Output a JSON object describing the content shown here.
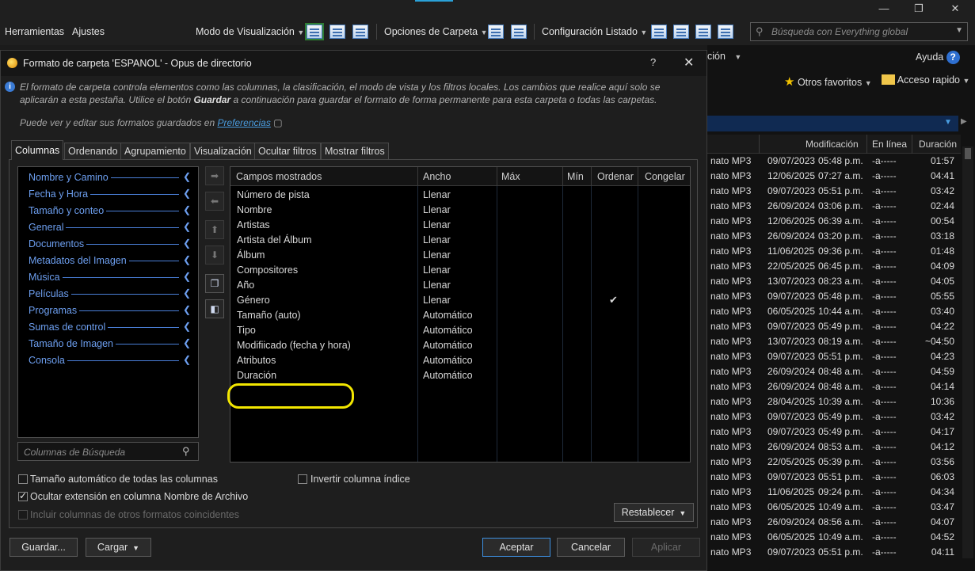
{
  "window": {
    "minimize_glyph": "—",
    "maximize_glyph": "❐",
    "close_glyph": "✕"
  },
  "toolbar": {
    "herramientas": "Herramientas",
    "ajustes": "Ajustes",
    "modo_visualizacion": "Modo de Visualización",
    "opciones_carpeta": "Opciones de Carpeta",
    "configuracion_listado": "Configuración Listado",
    "search_placeholder": "Búsqueda con Everything global"
  },
  "background": {
    "menu_fragment": "ción",
    "ayuda": "Ayuda",
    "otros_favoritos": "Otros favoritos",
    "acceso_rapido": "Acceso rapido",
    "columns": [
      "Modificación",
      "En línea",
      "Duración"
    ],
    "rows": [
      {
        "type": "nato MP3",
        "date": "09/07/2023",
        "time": "05:48 p.m.",
        "attr": "-a-----",
        "dur": "01:57"
      },
      {
        "type": "nato MP3",
        "date": "12/06/2025",
        "time": "07:27 a.m.",
        "attr": "-a-----",
        "dur": "04:41"
      },
      {
        "type": "nato MP3",
        "date": "09/07/2023",
        "time": "05:51 p.m.",
        "attr": "-a-----",
        "dur": "03:42"
      },
      {
        "type": "nato MP3",
        "date": "26/09/2024",
        "time": "03:06 p.m.",
        "attr": "-a-----",
        "dur": "02:44"
      },
      {
        "type": "nato MP3",
        "date": "12/06/2025",
        "time": "06:39 a.m.",
        "attr": "-a-----",
        "dur": "00:54"
      },
      {
        "type": "nato MP3",
        "date": "26/09/2024",
        "time": "03:20 p.m.",
        "attr": "-a-----",
        "dur": "03:18"
      },
      {
        "type": "nato MP3",
        "date": "11/06/2025",
        "time": "09:36 p.m.",
        "attr": "-a-----",
        "dur": "01:48"
      },
      {
        "type": "nato MP3",
        "date": "22/05/2025",
        "time": "06:45 p.m.",
        "attr": "-a-----",
        "dur": "04:09"
      },
      {
        "type": "nato MP3",
        "date": "13/07/2023",
        "time": "08:23 a.m.",
        "attr": "-a-----",
        "dur": "04:05"
      },
      {
        "type": "nato MP3",
        "date": "09/07/2023",
        "time": "05:48 p.m.",
        "attr": "-a-----",
        "dur": "05:55"
      },
      {
        "type": "nato MP3",
        "date": "06/05/2025",
        "time": "10:44 a.m.",
        "attr": "-a-----",
        "dur": "03:40"
      },
      {
        "type": "nato MP3",
        "date": "09/07/2023",
        "time": "05:49 p.m.",
        "attr": "-a-----",
        "dur": "04:22"
      },
      {
        "type": "nato MP3",
        "date": "13/07/2023",
        "time": "08:19 a.m.",
        "attr": "-a-----",
        "dur": "~04:50"
      },
      {
        "type": "nato MP3",
        "date": "09/07/2023",
        "time": "05:51 p.m.",
        "attr": "-a-----",
        "dur": "04:23"
      },
      {
        "type": "nato MP3",
        "date": "26/09/2024",
        "time": "08:48 a.m.",
        "attr": "-a-----",
        "dur": "04:59"
      },
      {
        "type": "nato MP3",
        "date": "26/09/2024",
        "time": "08:48 a.m.",
        "attr": "-a-----",
        "dur": "04:14"
      },
      {
        "type": "nato MP3",
        "date": "28/04/2025",
        "time": "10:39 a.m.",
        "attr": "-a-----",
        "dur": "10:36"
      },
      {
        "type": "nato MP3",
        "date": "09/07/2023",
        "time": "05:49 p.m.",
        "attr": "-a-----",
        "dur": "03:42"
      },
      {
        "type": "nato MP3",
        "date": "09/07/2023",
        "time": "05:49 p.m.",
        "attr": "-a-----",
        "dur": "04:17"
      },
      {
        "type": "nato MP3",
        "date": "26/09/2024",
        "time": "08:53 a.m.",
        "attr": "-a-----",
        "dur": "04:12"
      },
      {
        "type": "nato MP3",
        "date": "22/05/2025",
        "time": "05:39 p.m.",
        "attr": "-a-----",
        "dur": "03:56"
      },
      {
        "type": "nato MP3",
        "date": "09/07/2023",
        "time": "05:51 p.m.",
        "attr": "-a-----",
        "dur": "06:03"
      },
      {
        "type": "nato MP3",
        "date": "11/06/2025",
        "time": "09:24 p.m.",
        "attr": "-a-----",
        "dur": "04:34"
      },
      {
        "type": "nato MP3",
        "date": "06/05/2025",
        "time": "10:49 a.m.",
        "attr": "-a-----",
        "dur": "03:47"
      },
      {
        "type": "nato MP3",
        "date": "26/09/2024",
        "time": "08:56 a.m.",
        "attr": "-a-----",
        "dur": "04:07"
      },
      {
        "type": "nato MP3",
        "date": "06/05/2025",
        "time": "10:49 a.m.",
        "attr": "-a-----",
        "dur": "04:52"
      },
      {
        "type": "nato MP3",
        "date": "09/07/2023",
        "time": "05:51 p.m.",
        "attr": "-a-----",
        "dur": "04:11"
      }
    ]
  },
  "dialog": {
    "title": "Formato de carpeta 'ESPANOL' - Opus de directorio",
    "help": "?",
    "close": "✕",
    "info_part1": "El formato de carpeta controla elementos como las columnas, la clasificación, el modo de vista y los filtros locales. Los cambios que realice aquí solo se aplicarán a esta pestaña. Utilice el botón ",
    "info_bold": "Guardar",
    "info_part2": " a continuación para guardar el formato de forma permanente para esta carpeta o todas las carpetas.",
    "pref_text": "Puede ver y editar sus formatos guardados en ",
    "pref_link": "Preferencias",
    "tabs": [
      "Columnas",
      "Ordenando",
      "Agrupamiento",
      "Visualización",
      "Ocultar filtros",
      "Mostrar filtros"
    ],
    "categories": [
      "Nombre y Camino",
      "Fecha y Hora",
      "Tamaño y conteo",
      "General",
      "Documentos",
      "Metadatos del Imagen",
      "Música",
      "Películas",
      "Programas",
      "Sumas de control",
      "Tamaño de Imagen",
      "Consola"
    ],
    "column_search_placeholder": "Columnas de Búsqueda",
    "table_headers": {
      "fields": "Campos mostrados",
      "width": "Ancho",
      "max": "Máx",
      "min": "Mín",
      "sort": "Ordenar",
      "freeze": "Congelar"
    },
    "fields": [
      {
        "name": "Número de pista",
        "width": "Llenar",
        "sort": ""
      },
      {
        "name": "Nombre",
        "width": "Llenar",
        "sort": ""
      },
      {
        "name": "Artistas",
        "width": "Llenar",
        "sort": ""
      },
      {
        "name": "Artista del Álbum",
        "width": "Llenar",
        "sort": ""
      },
      {
        "name": "Álbum",
        "width": "Llenar",
        "sort": ""
      },
      {
        "name": "Compositores",
        "width": "Llenar",
        "sort": ""
      },
      {
        "name": "Año",
        "width": "Llenar",
        "sort": ""
      },
      {
        "name": "Género",
        "width": "Llenar",
        "sort": "✔"
      },
      {
        "name": "Tamaño (auto)",
        "width": "Automático",
        "sort": ""
      },
      {
        "name": "Tipo",
        "width": "Automático",
        "sort": ""
      },
      {
        "name": "Modifiicado (fecha y hora)",
        "width": "Automático",
        "sort": ""
      },
      {
        "name": "Atributos",
        "width": "Automático",
        "sort": ""
      },
      {
        "name": "Duración",
        "width": "Automático",
        "sort": ""
      }
    ],
    "checkboxes": {
      "auto_size": "Tamaño automático de todas las columnas",
      "hide_ext": "Ocultar extensión en columna Nombre de Archivo",
      "include_cols": "Incluir columnas de otros formatos coincidentes",
      "invert_index": "Invertir columna índice"
    },
    "buttons": {
      "restablecer": "Restablecer",
      "guardar": "Guardar...",
      "cargar": "Cargar",
      "aceptar": "Aceptar",
      "cancelar": "Cancelar",
      "aplicar": "Aplicar"
    }
  },
  "colors": {
    "accent": "#2aa1d8",
    "link": "#4a9de0",
    "category": "#6d9ff0",
    "highlight": "#f2e600"
  }
}
